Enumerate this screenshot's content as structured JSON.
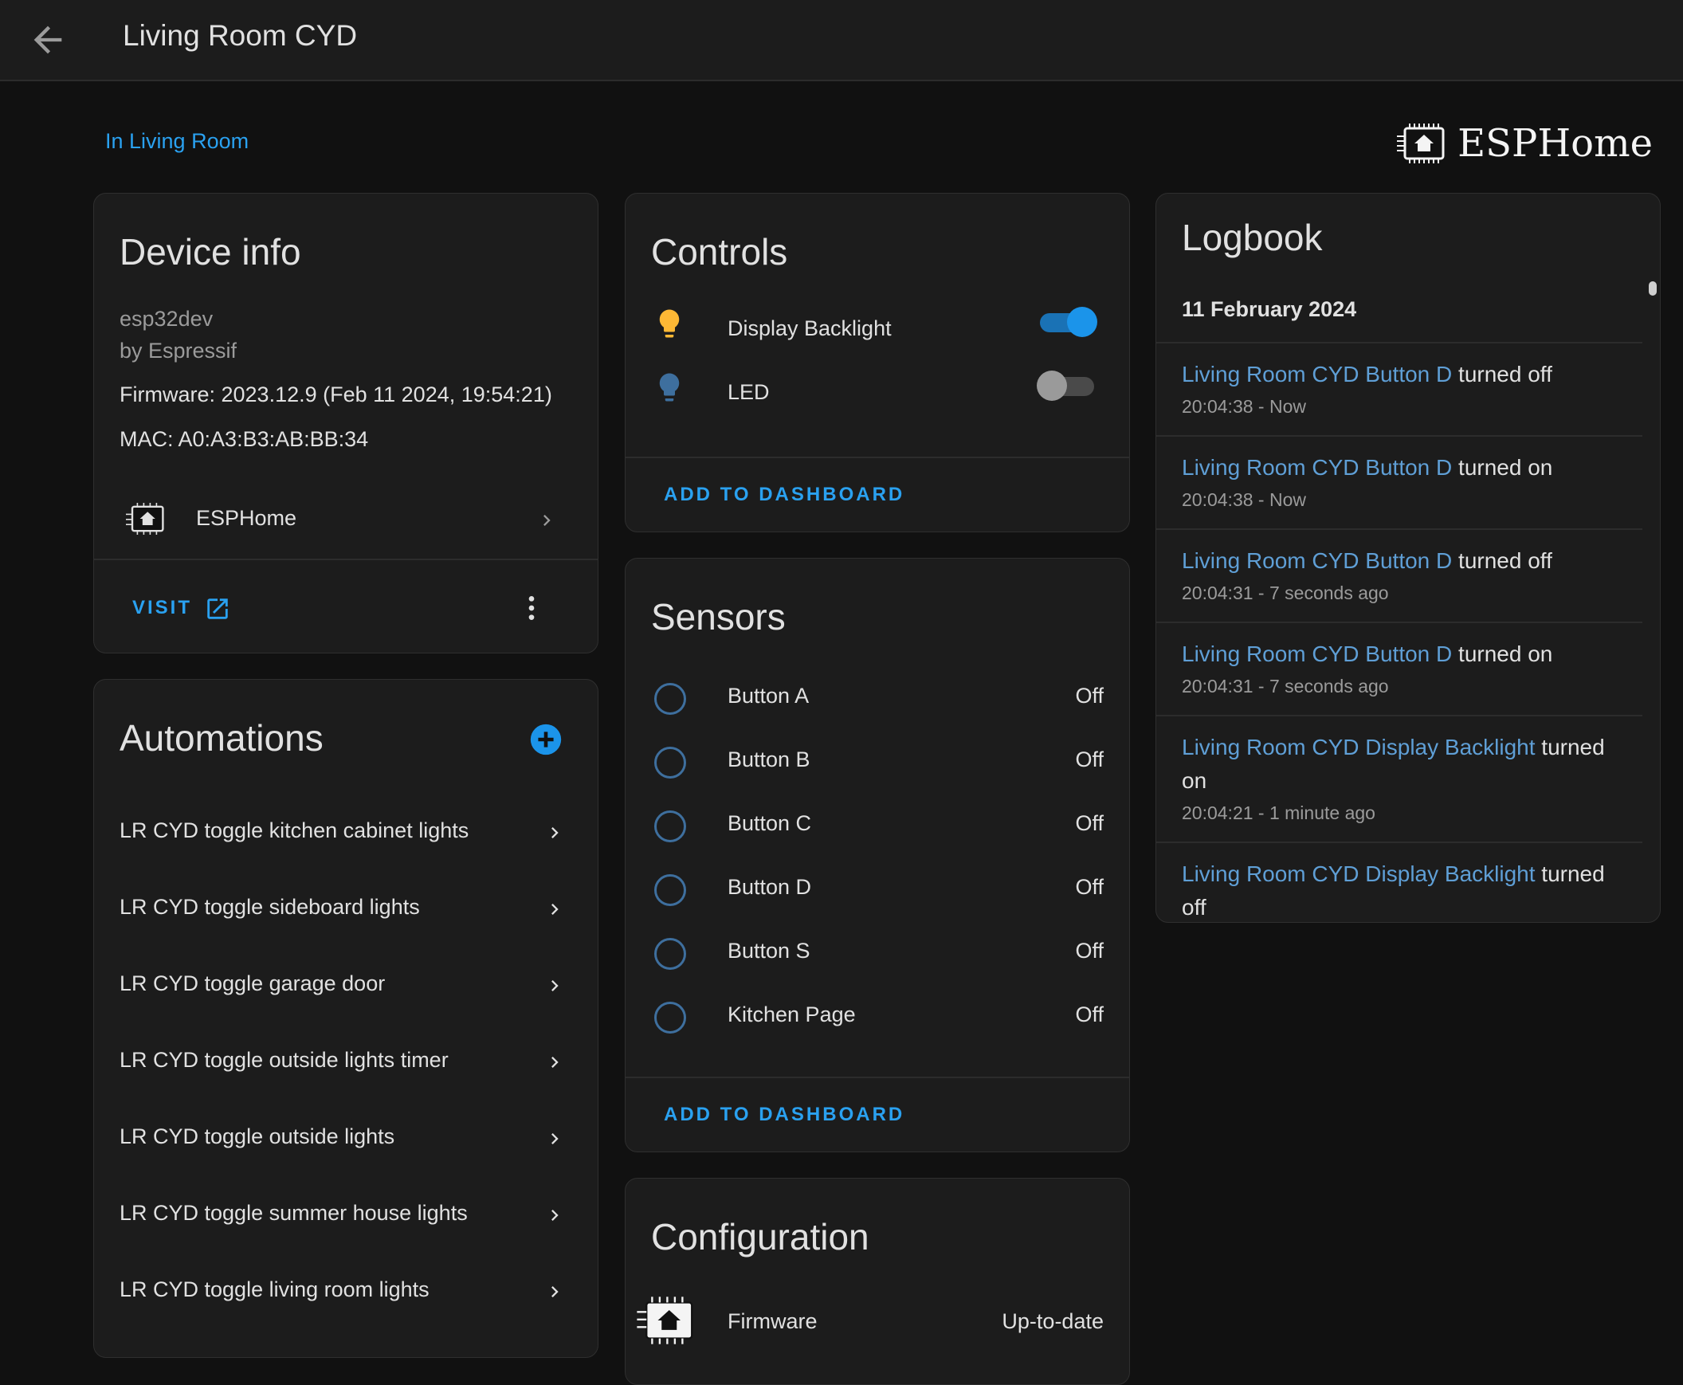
{
  "header": {
    "title": "Living Room CYD",
    "back_icon": "arrow-left-icon"
  },
  "area_link": "In Living Room",
  "brand": {
    "name": "ESPHome",
    "icon": "esphome-logo"
  },
  "device_info": {
    "title": "Device info",
    "model": "esp32dev",
    "manufacturer": "by Espressif",
    "firmware": "Firmware: 2023.12.9 (Feb 11 2024, 19:54:21)",
    "mac": "MAC: A0:A3:B3:AB:BB:34",
    "integration": "ESPHome",
    "visit_label": "VISIT"
  },
  "automations": {
    "title": "Automations",
    "items": [
      {
        "label": "LR CYD toggle kitchen cabinet lights"
      },
      {
        "label": "LR CYD toggle sideboard lights"
      },
      {
        "label": "LR CYD toggle garage door"
      },
      {
        "label": "LR CYD toggle outside lights timer"
      },
      {
        "label": "LR CYD toggle outside lights"
      },
      {
        "label": "LR CYD toggle summer house lights"
      },
      {
        "label": "LR CYD toggle living room lights"
      }
    ]
  },
  "controls": {
    "title": "Controls",
    "items": [
      {
        "label": "Display Backlight",
        "state": "on",
        "icon_color": "#fdb835"
      },
      {
        "label": "LED",
        "state": "off",
        "icon_color": "#3e6f9e"
      }
    ],
    "add_label": "ADD TO DASHBOARD"
  },
  "sensors": {
    "title": "Sensors",
    "items": [
      {
        "label": "Button A",
        "value": "Off"
      },
      {
        "label": "Button B",
        "value": "Off"
      },
      {
        "label": "Button C",
        "value": "Off"
      },
      {
        "label": "Button D",
        "value": "Off"
      },
      {
        "label": "Button S",
        "value": "Off"
      },
      {
        "label": "Kitchen Page",
        "value": "Off"
      }
    ],
    "add_label": "ADD TO DASHBOARD"
  },
  "configuration": {
    "title": "Configuration",
    "items": [
      {
        "label": "Firmware",
        "value": "Up-to-date"
      }
    ]
  },
  "logbook": {
    "title": "Logbook",
    "date": "11 February 2024",
    "entries": [
      {
        "entity": "Living Room CYD Button D",
        "action": "turned off",
        "time": "20:04:38 - Now"
      },
      {
        "entity": "Living Room CYD Button D",
        "action": "turned on",
        "time": "20:04:38 - Now"
      },
      {
        "entity": "Living Room CYD Button D",
        "action": "turned off",
        "time": "20:04:31 - 7 seconds ago"
      },
      {
        "entity": "Living Room CYD Button D",
        "action": "turned on",
        "time": "20:04:31 - 7 seconds ago"
      },
      {
        "entity": "Living Room CYD Display Backlight",
        "action": "turned on",
        "time": "20:04:21 - 1 minute ago"
      },
      {
        "entity": "Living Room CYD Display Backlight",
        "action": "turned off",
        "time": ""
      }
    ]
  },
  "colors": {
    "accent": "#2aa1f0",
    "background": "#111111",
    "card": "#1c1c1c"
  }
}
